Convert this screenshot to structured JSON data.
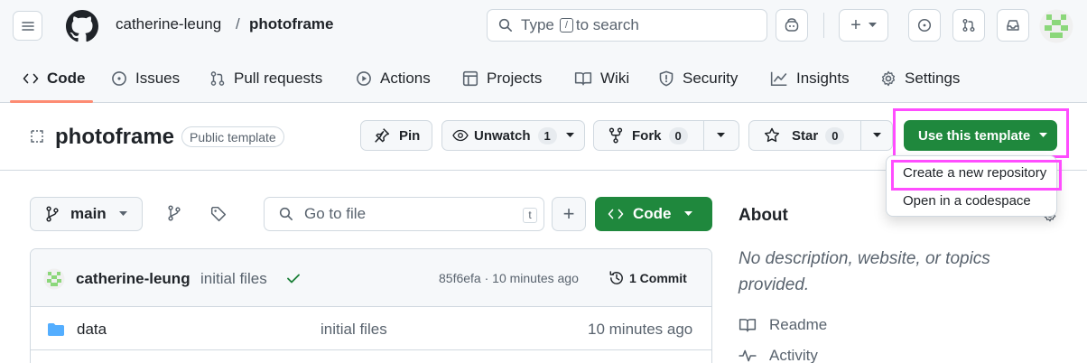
{
  "header": {
    "owner": "catherine-leung",
    "separator": "/",
    "repo": "photoframe",
    "search": {
      "prefix": "Type",
      "key": "/",
      "suffix": "to search"
    },
    "new_label": "+"
  },
  "tabs": [
    {
      "label": "Code",
      "icon": "code-icon"
    },
    {
      "label": "Issues",
      "icon": "issue-icon"
    },
    {
      "label": "Pull requests",
      "icon": "pull-request-icon"
    },
    {
      "label": "Actions",
      "icon": "play-icon"
    },
    {
      "label": "Projects",
      "icon": "table-icon"
    },
    {
      "label": "Wiki",
      "icon": "book-icon"
    },
    {
      "label": "Security",
      "icon": "shield-icon"
    },
    {
      "label": "Insights",
      "icon": "graph-icon"
    },
    {
      "label": "Settings",
      "icon": "gear-icon"
    }
  ],
  "repo": {
    "name": "photoframe",
    "visibility": "Public template",
    "pin_label": "Pin",
    "unwatch_label": "Unwatch",
    "watch_count": "1",
    "fork_label": "Fork",
    "fork_count": "0",
    "star_label": "Star",
    "star_count": "0",
    "template_label": "Use this template"
  },
  "template_menu": {
    "items": [
      "Create a new repository",
      "Open in a codespace"
    ]
  },
  "files": {
    "branch": "main",
    "goto_placeholder": "Go to file",
    "goto_key": "t",
    "add_label": "+",
    "code_label": "Code",
    "commit": {
      "author": "catherine-leung",
      "message": "initial files",
      "hash_time": "85f6efa · 10 minutes ago",
      "commits_label": "1 Commit"
    },
    "rows": [
      {
        "name": "data",
        "message": "initial files",
        "time": "10 minutes ago"
      }
    ]
  },
  "about": {
    "title": "About",
    "description": "No description, website, or topics provided.",
    "links": [
      {
        "label": "Readme",
        "icon": "book-icon"
      },
      {
        "label": "Activity",
        "icon": "pulse-icon"
      }
    ]
  },
  "colors": {
    "accent_green": "#1f883d",
    "highlight": "#ff4dff",
    "tab_underline": "#fd8c73",
    "folder": "#54aeff"
  }
}
